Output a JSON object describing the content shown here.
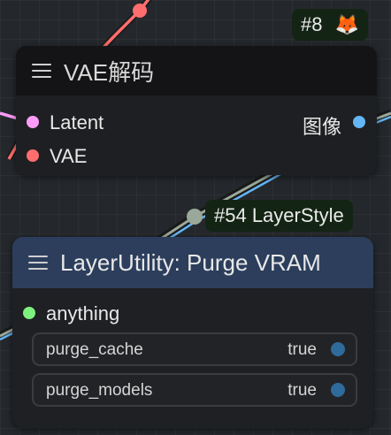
{
  "badges": {
    "vae_node_id": "#8",
    "purge_node_badge": "#54 LayerStyle"
  },
  "vae_decode_node": {
    "title": "VAE解码",
    "inputs": [
      "Latent",
      "VAE"
    ],
    "output": "图像"
  },
  "purge_vram_node": {
    "title": "LayerUtility: Purge VRAM",
    "input": "anything",
    "widgets": [
      {
        "name": "purge_cache",
        "value": "true"
      },
      {
        "name": "purge_models",
        "value": "true"
      }
    ]
  },
  "colors": {
    "latent": "#ff9cf9",
    "vae": "#ff6e6e",
    "image": "#64b5f6",
    "any": "#7ef07e",
    "toggle": "#2e6a9a",
    "purge_header": "#2c3e5c"
  },
  "icons": [
    "menu-icon",
    "fox-emoji-icon"
  ]
}
